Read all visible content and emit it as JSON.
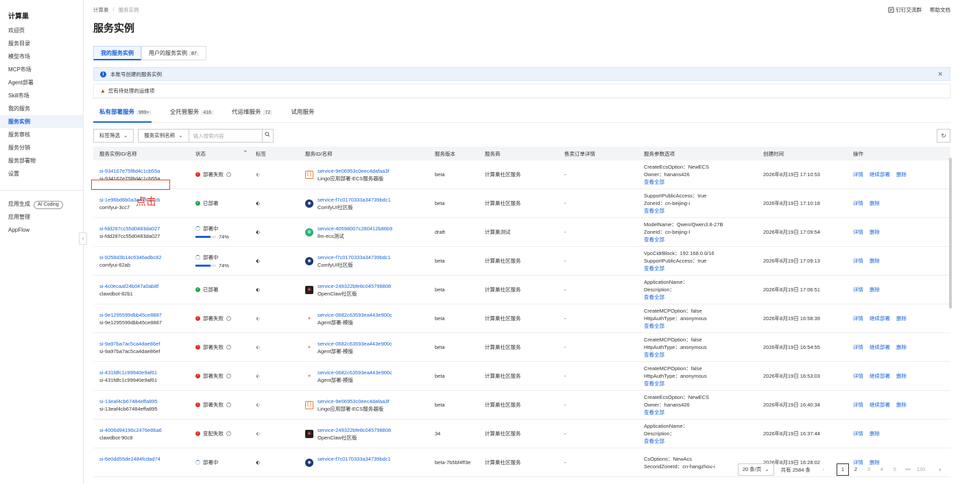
{
  "sidebar": {
    "brand": "计算巢",
    "items": [
      {
        "label": "欢迎页"
      },
      {
        "label": "服务目录"
      },
      {
        "label": "模型市场"
      },
      {
        "label": "MCP市场"
      },
      {
        "label": "Agent部署"
      },
      {
        "label": "Skill市场"
      },
      {
        "label": "我的服务"
      },
      {
        "label": "服务实例",
        "active": true
      },
      {
        "label": "服务审核"
      },
      {
        "label": "服务分销"
      },
      {
        "label": "服务部署物"
      },
      {
        "label": "设置"
      }
    ],
    "extra": [
      {
        "label": "应用生成",
        "badge": "AI Coding"
      },
      {
        "label": "应用管理"
      },
      {
        "label": "AppFlow"
      }
    ],
    "collapse_glyph": "‹"
  },
  "topbar": {
    "breadcrumb": [
      "计算巢",
      "服务实例"
    ],
    "links": [
      "钉钉交流群",
      "帮助文档"
    ]
  },
  "page_title": "服务实例",
  "tabs": [
    {
      "label": "我的服务实例",
      "active": true,
      "count": ""
    },
    {
      "label": "用户的服务实例",
      "active": false,
      "count": "87"
    }
  ],
  "info_bar": {
    "text": "本账号创建的服务实例"
  },
  "warn_bar": {
    "text": "您有待处理的运维项"
  },
  "subtabs": [
    {
      "label": "私有部署服务",
      "count": "999+",
      "active": true
    },
    {
      "label": "全托管服务",
      "count": "416"
    },
    {
      "label": "代运维服务",
      "count": "72"
    },
    {
      "label": "试用服务",
      "count": ""
    }
  ],
  "filters": {
    "tag_filter": "标签筛选",
    "field_select": "服务实例名称",
    "search_placeholder": "输入搜索内容"
  },
  "columns": [
    "服务实例ID/名称",
    "状态",
    "标签",
    "服务ID/名称",
    "服务版本",
    "服务商",
    "售卖订单详情",
    "服务参数选项",
    "创建时间",
    "操作"
  ],
  "rows": [
    {
      "id": "si-934167e75f8d4c1cb55a",
      "name": "si-934167e75f8d4c1cb55a",
      "status": "部署失败",
      "status_type": "fail",
      "progress": "",
      "tag_dark": false,
      "svc_icon": "lingo",
      "svc_id": "service-9e06953c0eec4dafaa3f",
      "svc_name": "Lingo应用部署-ECS服务器版",
      "version": "beta",
      "vendor": "计算巢社区服务",
      "order": "-",
      "params": [
        "CreateEcsOption：NewECS",
        "Owner：hanans426"
      ],
      "more": "查看全部",
      "created": "2026年8月19日 17:10:53",
      "ops": [
        "详情",
        "继续部署",
        "删除"
      ]
    },
    {
      "id": "si-1e96bd6b0a3a47fc84cb",
      "name": "comfyui-3cc7",
      "status": "已部署",
      "status_type": "ok",
      "progress": "",
      "tag_dark": true,
      "svc_icon": "comfy",
      "svc_id": "service-f7c0170333a34739bdc1",
      "svc_name": "ComfyUI社区版",
      "version": "beta",
      "vendor": "计算巢社区服务",
      "order": "-",
      "params": [
        "SupportPublicAccess：true",
        "ZoneId：cn-beijing-i"
      ],
      "more": "查看全部",
      "created": "2026年8月19日 17:10:18",
      "ops": [
        "详情",
        "删除"
      ]
    },
    {
      "id": "si-fdd287cc55d0483da027",
      "name": "si-fdd287cc55d0483da027",
      "status": "部署中",
      "status_type": "spin",
      "progress": "74%",
      "progress_value": 74,
      "tag_dark": true,
      "svc_icon": "llm",
      "svc_id": "service-40598007c280412b86b9",
      "svc_name": "llm-ecs测试",
      "version": "draft",
      "vendor": "计算巢测试",
      "order": "-",
      "params": [
        "ModelName：Qwen/Qwen3.8-27B",
        "ZoneId：cn-beijing-l"
      ],
      "more": "查看全部",
      "created": "2026年8月19日 17:09:54",
      "ops": [
        "详情",
        "删除"
      ]
    },
    {
      "id": "si-9258d3b14c6346adbc82",
      "name": "comfyui-62ab",
      "status": "部署中",
      "status_type": "spin",
      "progress": "74%",
      "progress_value": 74,
      "tag_dark": true,
      "svc_icon": "comfy",
      "svc_id": "service-f7c0170333a34739bdc1",
      "svc_name": "ComfyUI社区版",
      "version": "beta",
      "vendor": "计算巢社区服务",
      "order": "-",
      "params": [
        "VpcCidrBlock：192.168.0.0/16",
        "SupportPublicAccess：true"
      ],
      "more": "查看全部",
      "created": "2026年8月19日 17:09:13",
      "ops": [
        "详情",
        "删除"
      ]
    },
    {
      "id": "si-4c0ecaaf24b047a0ab8f",
      "name": "clawdbot-82b1",
      "status": "已部署",
      "status_type": "ok",
      "progress": "",
      "tag_dark": true,
      "svc_icon": "claw",
      "svc_id": "service-249322bfe8c045798808",
      "svc_name": "OpenClaw社区版",
      "version": "beta",
      "vendor": "计算巢社区服务",
      "order": "-",
      "params": [
        "ApplicationName：",
        "Description："
      ],
      "more": "查看全部",
      "created": "2026年8月19日 17:06:51",
      "ops": [
        "详情",
        "删除"
      ]
    },
    {
      "id": "si-9e1295599dbb45ce8887",
      "name": "si-9e1295599dbb45ce8887",
      "status": "部署失败",
      "status_type": "fail",
      "progress": "",
      "tag_dark": false,
      "svc_icon": "agent",
      "svc_id": "service-0682c63593ea443e900c",
      "svc_name": "Agent部署-模版",
      "version": "beta",
      "vendor": "计算巢社区服务",
      "order": "-",
      "params": [
        "CreateMCPOption：false",
        "HttpAuthType：anonymous"
      ],
      "more": "查看全部",
      "created": "2026年8月19日 16:58:39",
      "ops": [
        "详情",
        "继续部署",
        "删除"
      ]
    },
    {
      "id": "si-9a97ba7ac5ca4dae86ef",
      "name": "si-9a97ba7ac5ca4dae86ef",
      "status": "部署失败",
      "status_type": "fail",
      "progress": "",
      "tag_dark": false,
      "svc_icon": "agent",
      "svc_id": "service-0682c63593ea443e900c",
      "svc_name": "Agent部署-模版",
      "version": "beta",
      "vendor": "计算巢社区服务",
      "order": "-",
      "params": [
        "CreateMCPOption：false",
        "HttpAuthType：anonymous"
      ],
      "more": "查看全部",
      "created": "2026年8月19日 16:54:55",
      "ops": [
        "详情",
        "继续部署",
        "删除"
      ]
    },
    {
      "id": "si-431fdfc1c99940e9af61",
      "name": "si-431fdfc1c99940e9af61",
      "status": "部署失败",
      "status_type": "fail",
      "progress": "",
      "tag_dark": false,
      "svc_icon": "agent",
      "svc_id": "service-0682c63593ea443e900c",
      "svc_name": "Agent部署-模版",
      "version": "beta",
      "vendor": "计算巢社区服务",
      "order": "-",
      "params": [
        "CreateMCPOption：false",
        "HttpAuthType：anonymous"
      ],
      "more": "查看全部",
      "created": "2026年8月19日 16:53:03",
      "ops": [
        "详情",
        "继续部署",
        "删除"
      ]
    },
    {
      "id": "si-13eaf4cb67484effa895",
      "name": "si-13eaf4cb67484effa895",
      "status": "部署失败",
      "status_type": "fail",
      "progress": "",
      "tag_dark": false,
      "svc_icon": "lingo",
      "svc_id": "service-9e06953c0eec4dafaa3f",
      "svc_name": "Lingo应用部署-ECS服务器版",
      "version": "beta",
      "vendor": "计算巢社区服务",
      "order": "-",
      "params": [
        "CreateEcsOption：NewECS",
        "Owner：hanans426"
      ],
      "more": "查看全部",
      "created": "2026年8月19日 16:40:34",
      "ops": [
        "详情",
        "继续部署",
        "删除"
      ]
    },
    {
      "id": "si-4006d94196c2476e86a6",
      "name": "clawdbot-90c8",
      "status": "变配失败",
      "status_type": "fail",
      "progress": "",
      "tag_dark": false,
      "svc_icon": "claw",
      "svc_id": "service-249322bfe8c045798808",
      "svc_name": "OpenClaw社区版",
      "version": "34",
      "vendor": "计算巢社区服务",
      "order": "-",
      "params": [
        "ApplicationName：",
        "Description："
      ],
      "more": "查看全部",
      "created": "2026年8月19日 16:37:44",
      "ops": [
        "详情",
        "删除"
      ]
    },
    {
      "id": "si-6e0dd55de2484fcdad74",
      "name": "",
      "status": "部署中",
      "status_type": "spin",
      "progress": "",
      "tag_dark": true,
      "svc_icon": "comfy",
      "svc_id": "service-f7c0170333a34739bdc1",
      "svc_name": "",
      "version": "beta-7b5bf4ff3e",
      "vendor": "计算巢社区服务",
      "order": "-",
      "params": [
        "CsOptions：NewAcs",
        "SecondZoneId：cn-hangzhou-i"
      ],
      "more": "",
      "created": "2026年8月19日 16:28:02",
      "ops": [
        "详情",
        "删除"
      ]
    }
  ],
  "annotation": {
    "text": "点击"
  },
  "pagination": {
    "page_size": "20 条/页",
    "total": "共有 2584 条",
    "pages": [
      "1",
      "2",
      "3",
      "4",
      "5",
      "•••",
      "130"
    ],
    "current": "1",
    "prev": "‹",
    "next": "›"
  },
  "colors": {
    "accent": "#1a63d8",
    "fail": "#d9342b",
    "ok": "#22a34a",
    "annotation": "#e0412f"
  }
}
